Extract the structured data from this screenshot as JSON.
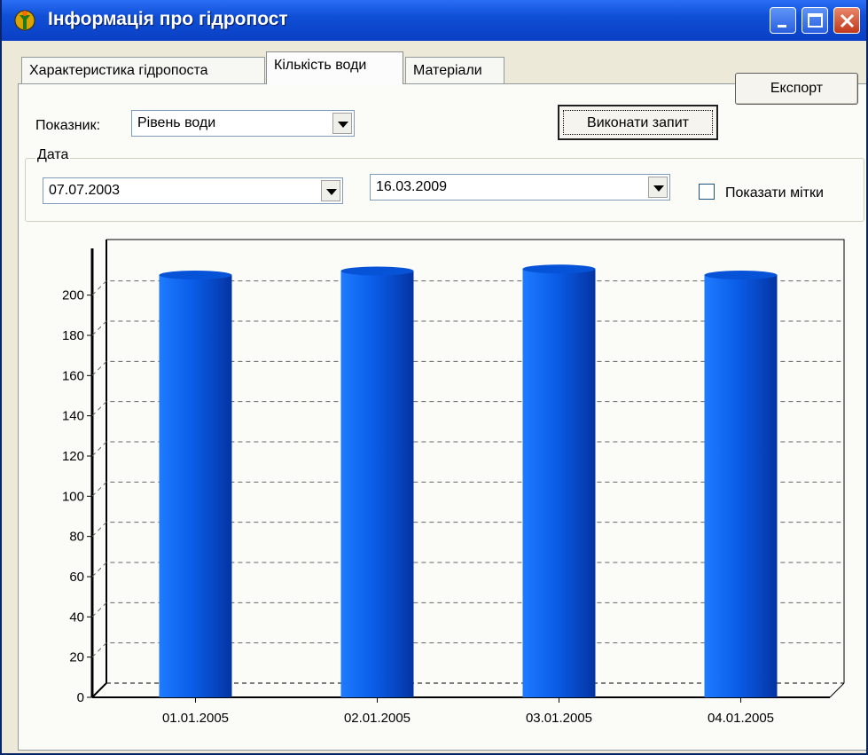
{
  "window": {
    "title": "Інформація про гідропост",
    "title_bar_color": "#0a3fc4"
  },
  "tabs": [
    {
      "label": "Характеристика гідропоста",
      "active": false
    },
    {
      "label": "Кількість води",
      "active": true
    },
    {
      "label": "Матеріали",
      "active": false
    }
  ],
  "toolbar": {
    "export_label": "Експорт",
    "run_query_label": "Виконати запит"
  },
  "indicator": {
    "label": "Показник:",
    "selected": "Рівень води"
  },
  "date_group": {
    "legend": "Дата",
    "from": "07.07.2003",
    "to": "16.03.2009",
    "show_labels_text": "Показати мітки",
    "show_labels_checked": false
  },
  "chart_data": {
    "type": "bar",
    "categories": [
      "01.01.2005",
      "02.01.2005",
      "03.01.2005",
      "04.01.2005"
    ],
    "values": [
      210,
      212,
      213,
      210
    ],
    "ylim": [
      0,
      210
    ],
    "yticks": [
      0,
      20,
      40,
      60,
      80,
      100,
      120,
      140,
      160,
      180,
      200
    ],
    "grid": true,
    "bar_color": "#0a5de8",
    "title": "",
    "xlabel": "",
    "ylabel": ""
  }
}
